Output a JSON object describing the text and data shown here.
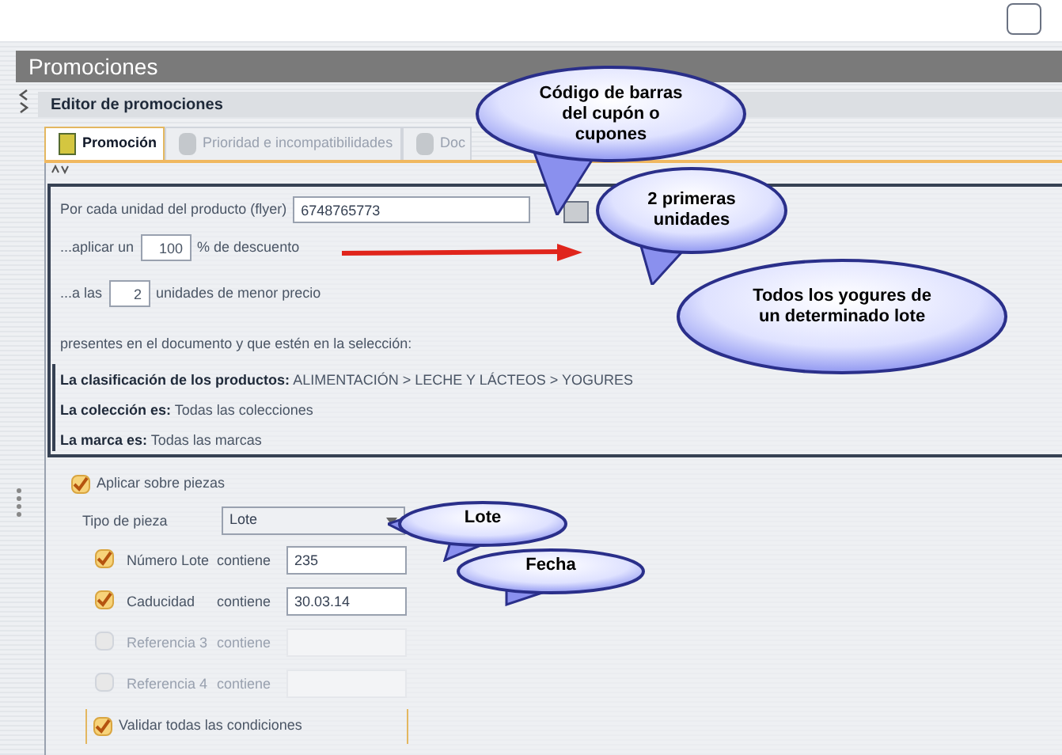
{
  "window": {
    "title": "Promociones"
  },
  "editor": {
    "title": "Editor de promociones"
  },
  "tabs": [
    {
      "label": "Promoción",
      "selected": true
    },
    {
      "label": "Prioridad e incompatibilidades",
      "selected": false
    },
    {
      "label": "Doc",
      "selected": false
    }
  ],
  "rule": {
    "product_label": "Por cada unidad del producto (flyer)",
    "product_code": "6748765773",
    "discount_prefix": "...aplicar un",
    "discount_value": "100",
    "discount_suffix": "% de descuento",
    "units_prefix": "...a las",
    "units_value": "2",
    "units_suffix": "unidades de menor precio",
    "scope_text": "presentes en el documento y que estén en la selección:"
  },
  "conditions": [
    {
      "label": "La clasificación de los productos:",
      "value": "ALIMENTACIÓN > LECHE Y LÁCTEOS > YOGURES"
    },
    {
      "label": "La colección es:",
      "value": "Todas las colecciones"
    },
    {
      "label": "La marca es:",
      "value": "Todas las marcas"
    }
  ],
  "pieces": {
    "label": "Aplicar sobre piezas",
    "checked": true,
    "type_label": "Tipo de pieza",
    "type_value": "Lote",
    "fields": [
      {
        "label": "Número Lote",
        "operator": "contiene",
        "value": "235",
        "checked": true,
        "disabled": false
      },
      {
        "label": "Caducidad",
        "operator": "contiene",
        "value": "30.03.14",
        "checked": true,
        "disabled": false
      },
      {
        "label": "Referencia 3",
        "operator": "contiene",
        "checked": false,
        "disabled": true
      },
      {
        "label": "Referencia 4",
        "operator": "contiene",
        "checked": false,
        "disabled": true
      }
    ],
    "validate_all": {
      "label": "Validar todas las condiciones",
      "checked": true
    }
  },
  "callouts": [
    {
      "text": "Código de barras del cupón o cupones"
    },
    {
      "text": "2 primeras unidades"
    },
    {
      "text": "Todos los yogures de un determinado lote"
    },
    {
      "text": "Lote"
    },
    {
      "text": "Fecha"
    }
  ]
}
